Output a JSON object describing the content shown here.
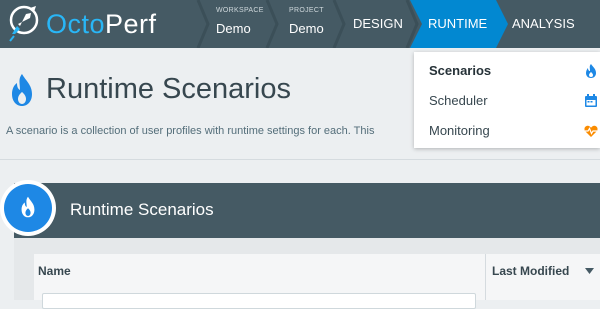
{
  "brand": {
    "part1": "Octo",
    "part2": "Perf"
  },
  "breadcrumbs": [
    {
      "caption": "WORKSPACE",
      "value": "Demo"
    },
    {
      "caption": "PROJECT",
      "value": "Demo"
    }
  ],
  "nav": {
    "design": "DESIGN",
    "runtime": "RUNTIME",
    "analysis": "ANALYSIS"
  },
  "dropdown": {
    "items": [
      {
        "label": "Scenarios",
        "icon": "flame-icon",
        "active": true
      },
      {
        "label": "Scheduler",
        "icon": "calendar-icon"
      },
      {
        "label": "Monitoring",
        "icon": "heartbeat-icon"
      }
    ]
  },
  "page": {
    "title": "Runtime Scenarios",
    "description": "A scenario is a collection of user profiles with runtime settings for each. This"
  },
  "panel": {
    "title": "Runtime Scenarios",
    "columns": {
      "name": "Name",
      "last_modified": "Last Modified"
    },
    "sort": "descending"
  },
  "colors": {
    "nav_bg": "#455a64",
    "accent": "#0288d1",
    "brand_blue": "#29b6f6",
    "page_bg": "#eceff1",
    "calendar": "#1e88e5",
    "heartbeat": "#fb8c00"
  }
}
